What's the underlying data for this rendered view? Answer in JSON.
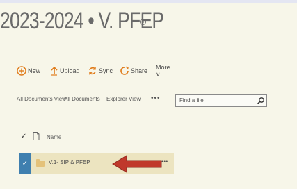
{
  "page": {
    "title": "2023-2024 • V. PFEP",
    "title_icon": "info-circle-icon"
  },
  "toolbar": {
    "new_label": "New",
    "upload_label": "Upload",
    "sync_label": "Sync",
    "share_label": "Share",
    "more_label": "More ∨",
    "icons": [
      "plus-circle-icon",
      "upload-arrow-icon",
      "sync-icon",
      "share-icon"
    ],
    "accent_color": "#e07b1a"
  },
  "views": {
    "all_documents_view": "All Documents View",
    "all_documents": "All Documents",
    "explorer_view": "Explorer View",
    "more": "•••"
  },
  "search": {
    "placeholder": "Find a file"
  },
  "list": {
    "header_check": "✓",
    "header_name": "Name",
    "rows": [
      {
        "check": "✓",
        "name": "V.1- SIP & PFEP",
        "more": "•••"
      }
    ],
    "selected_color": "#3f7faf",
    "row_highlight_color": "#ece4c0",
    "arrow_color": "#c0392b"
  }
}
